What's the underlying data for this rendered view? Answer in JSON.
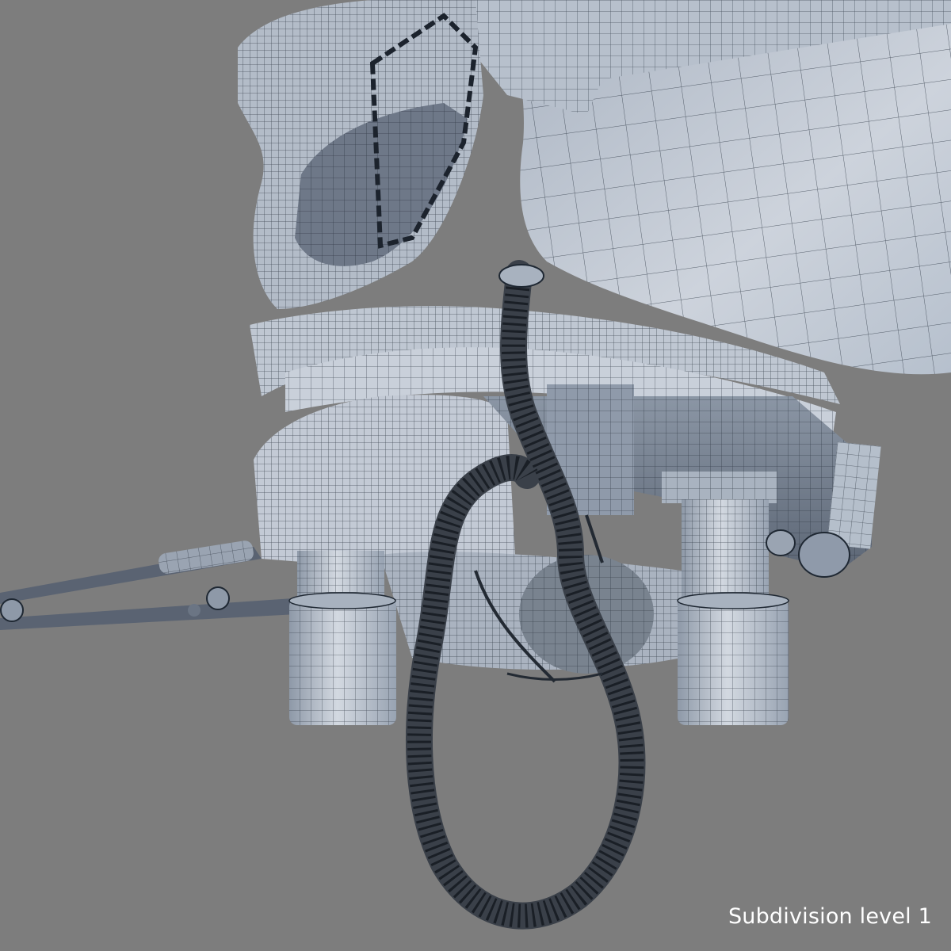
{
  "caption": "Subdivision level 1",
  "colors": {
    "background": "#7d7d7d",
    "surface": "#c5ccd6",
    "surface_shadow": "#8f9aaa",
    "wire": "#1f2833",
    "hose": "#3a4049"
  }
}
